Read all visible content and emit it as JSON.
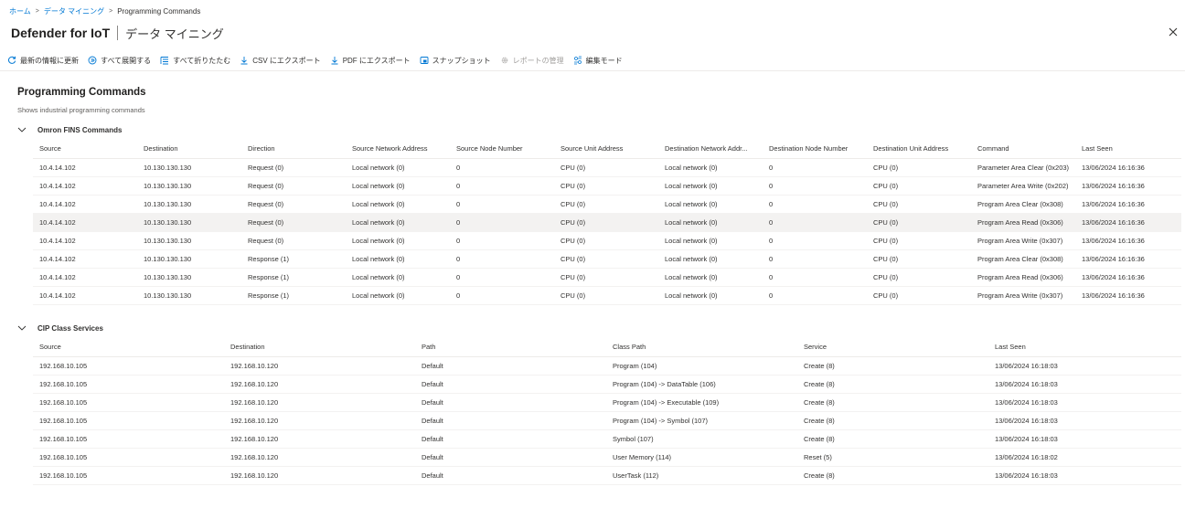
{
  "breadcrumb": {
    "items": [
      "ホーム",
      "データ マイニング"
    ],
    "current": "Programming Commands"
  },
  "header": {
    "title": "Defender for IoT",
    "subtitle": "データ マイニング"
  },
  "toolbar": {
    "refresh": "最新の情報に更新",
    "expand_all": "すべて展開する",
    "collapse_all": "すべて折りたたむ",
    "export_csv": "CSV にエクスポート",
    "export_pdf": "PDF にエクスポート",
    "snapshot": "スナップショット",
    "report_manage": "レポートの管理",
    "edit_mode": "編集モード"
  },
  "page": {
    "title": "Programming Commands",
    "description": "Shows industrial programming commands"
  },
  "omron": {
    "group_title": "Omron FINS Commands",
    "columns": [
      "Source",
      "Destination",
      "Direction",
      "Source Network Address",
      "Source Node Number",
      "Source Unit Address",
      "Destination Network Addr...",
      "Destination Node Number",
      "Destination Unit Address",
      "Command",
      "Last Seen"
    ],
    "rows": [
      [
        "10.4.14.102",
        "10.130.130.130",
        "Request (0)",
        "Local network (0)",
        "0",
        "CPU (0)",
        "Local network (0)",
        "0",
        "CPU (0)",
        "Parameter Area Clear (0x203)",
        "13/06/2024 16:16:36"
      ],
      [
        "10.4.14.102",
        "10.130.130.130",
        "Request (0)",
        "Local network (0)",
        "0",
        "CPU (0)",
        "Local network (0)",
        "0",
        "CPU (0)",
        "Parameter Area Write (0x202)",
        "13/06/2024 16:16:36"
      ],
      [
        "10.4.14.102",
        "10.130.130.130",
        "Request (0)",
        "Local network (0)",
        "0",
        "CPU (0)",
        "Local network (0)",
        "0",
        "CPU (0)",
        "Program Area Clear (0x308)",
        "13/06/2024 16:16:36"
      ],
      [
        "10.4.14.102",
        "10.130.130.130",
        "Request (0)",
        "Local network (0)",
        "0",
        "CPU (0)",
        "Local network (0)",
        "0",
        "CPU (0)",
        "Program Area Read (0x306)",
        "13/06/2024 16:16:36"
      ],
      [
        "10.4.14.102",
        "10.130.130.130",
        "Request (0)",
        "Local network (0)",
        "0",
        "CPU (0)",
        "Local network (0)",
        "0",
        "CPU (0)",
        "Program Area Write (0x307)",
        "13/06/2024 16:16:36"
      ],
      [
        "10.4.14.102",
        "10.130.130.130",
        "Response (1)",
        "Local network (0)",
        "0",
        "CPU (0)",
        "Local network (0)",
        "0",
        "CPU (0)",
        "Program Area Clear (0x308)",
        "13/06/2024 16:16:36"
      ],
      [
        "10.4.14.102",
        "10.130.130.130",
        "Response (1)",
        "Local network (0)",
        "0",
        "CPU (0)",
        "Local network (0)",
        "0",
        "CPU (0)",
        "Program Area Read (0x306)",
        "13/06/2024 16:16:36"
      ],
      [
        "10.4.14.102",
        "10.130.130.130",
        "Response (1)",
        "Local network (0)",
        "0",
        "CPU (0)",
        "Local network (0)",
        "0",
        "CPU (0)",
        "Program Area Write (0x307)",
        "13/06/2024 16:16:36"
      ]
    ],
    "selected_row": 3
  },
  "cip": {
    "group_title": "CIP Class Services",
    "columns": [
      "Source",
      "Destination",
      "Path",
      "Class Path",
      "Service",
      "Last Seen"
    ],
    "rows": [
      [
        "192.168.10.105",
        "192.168.10.120",
        "Default",
        "Program (104)",
        "Create (8)",
        "13/06/2024 16:18:03"
      ],
      [
        "192.168.10.105",
        "192.168.10.120",
        "Default",
        "Program (104) -> DataTable (106)",
        "Create (8)",
        "13/06/2024 16:18:03"
      ],
      [
        "192.168.10.105",
        "192.168.10.120",
        "Default",
        "Program (104) -> Executable (109)",
        "Create (8)",
        "13/06/2024 16:18:03"
      ],
      [
        "192.168.10.105",
        "192.168.10.120",
        "Default",
        "Program (104) -> Symbol (107)",
        "Create (8)",
        "13/06/2024 16:18:03"
      ],
      [
        "192.168.10.105",
        "192.168.10.120",
        "Default",
        "Symbol (107)",
        "Create (8)",
        "13/06/2024 16:18:03"
      ],
      [
        "192.168.10.105",
        "192.168.10.120",
        "Default",
        "User Memory (114)",
        "Reset (5)",
        "13/06/2024 16:18:02"
      ],
      [
        "192.168.10.105",
        "192.168.10.120",
        "Default",
        "UserTask (112)",
        "Create (8)",
        "13/06/2024 16:18:03"
      ]
    ]
  },
  "colors": {
    "accent": "#0078d4",
    "text": "#323130",
    "selected_row": "#f3f2f1",
    "disabled": "#a19f9d"
  },
  "icons": {
    "refresh": "refresh-icon",
    "expand": "expand-all-icon",
    "collapse": "collapse-all-icon",
    "download": "download-icon",
    "snapshot": "snapshot-icon",
    "gear": "gear-icon",
    "edit": "edit-mode-icon",
    "close": "close-icon",
    "chevron": "chevron-down-icon"
  }
}
